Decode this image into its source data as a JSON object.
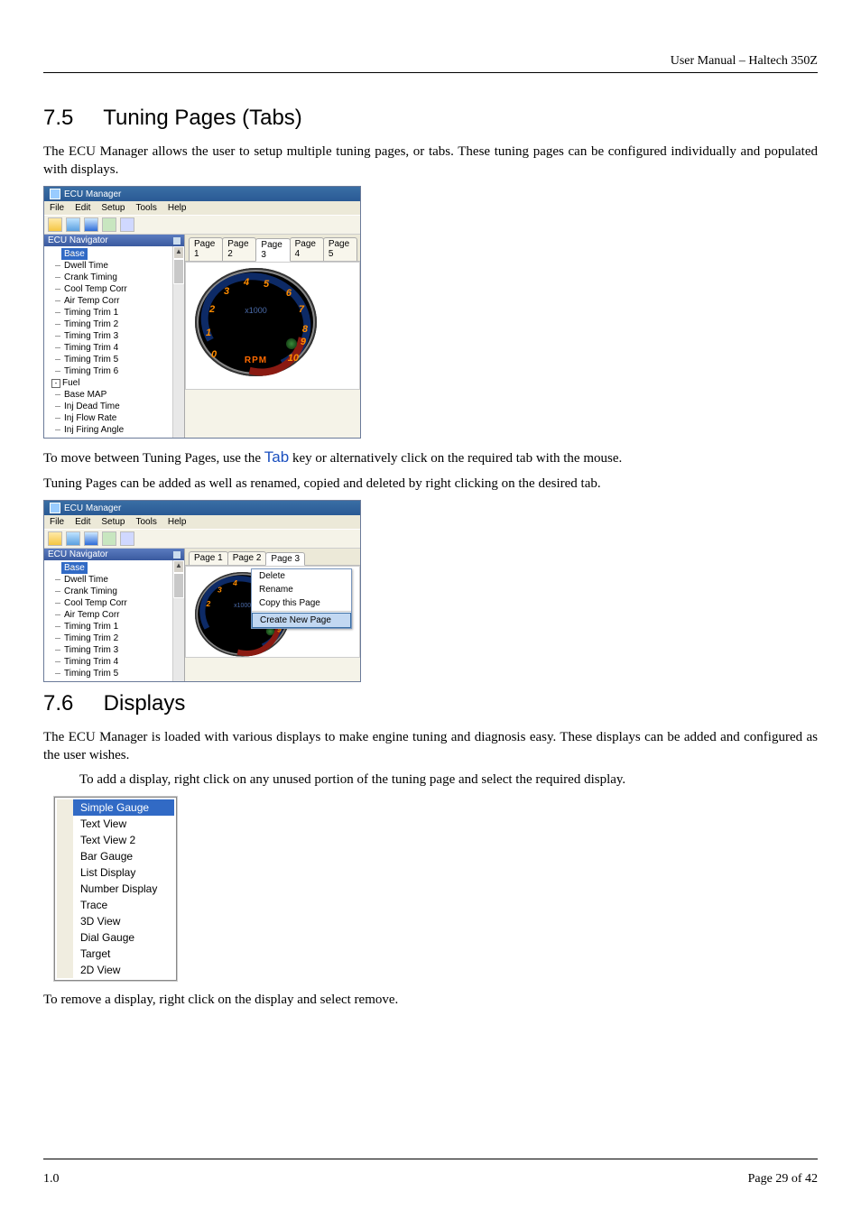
{
  "header": {
    "text": "User Manual – Haltech 350Z"
  },
  "section75": {
    "num": "7.5",
    "title": "Tuning Pages (Tabs)",
    "para1": "The ECU Manager allows the user to setup multiple tuning pages, or tabs. These tuning pages can be configured individually and populated with displays.",
    "para2a": "To move between Tuning Pages, use the ",
    "para2_tab": "Tab",
    "para2b": " key or alternatively click on the required tab with the mouse.",
    "para3": "Tuning Pages can be added as well as renamed, copied and deleted by right clicking on the desired tab."
  },
  "section76": {
    "num": "7.6",
    "title": "Displays",
    "para1": "The ECU Manager is loaded with various displays to make engine tuning and diagnosis easy. These displays can be added and configured as the user wishes.",
    "para2": "To add a display, right click on any unused portion of the tuning page and select the required display.",
    "para3": "To remove a display, right click on the display and select remove."
  },
  "ecuWindow": {
    "title": "ECU Manager",
    "menu": [
      "File",
      "Edit",
      "Setup",
      "Tools",
      "Help"
    ],
    "navTitle": "ECU Navigator",
    "navItems1": [
      "Base",
      "Dwell Time",
      "Crank Timing",
      "Cool Temp Corr",
      "Air Temp Corr",
      "Timing Trim 1",
      "Timing Trim 2",
      "Timing Trim 3",
      "Timing Trim 4",
      "Timing Trim 5",
      "Timing Trim 6"
    ],
    "navGroup": "Fuel",
    "navItems2": [
      "Base MAP",
      "Inj Dead Time",
      "Inj Flow Rate",
      "Inj Firing Angle"
    ],
    "navItemsShort": [
      "Base",
      "Dwell Time",
      "Crank Timing",
      "Cool Temp Corr",
      "Air Temp Corr",
      "Timing Trim 1",
      "Timing Trim 2",
      "Timing Trim 3",
      "Timing Trim 4",
      "Timing Trim 5"
    ],
    "tabs": [
      "Page 1",
      "Page 2",
      "Page 3",
      "Page 4",
      "Page 5"
    ],
    "gauge": {
      "ticks": [
        "0",
        "1",
        "2",
        "3",
        "4",
        "5",
        "6",
        "7",
        "8",
        "9",
        "10"
      ],
      "unit": "x1000",
      "label": "RPM"
    },
    "contextMenu": {
      "items": [
        "Delete",
        "Rename",
        "Copy this Page"
      ],
      "highlight": "Create New Page"
    }
  },
  "displayMenu": {
    "highlight": "Simple Gauge",
    "items": [
      "Text View",
      "Text View 2",
      "Bar Gauge",
      "List Display",
      "Number Display",
      "Trace",
      "3D View",
      "Dial Gauge",
      "Target",
      "2D View"
    ]
  },
  "footer": {
    "left": "1.0",
    "right": "Page 29 of 42"
  }
}
